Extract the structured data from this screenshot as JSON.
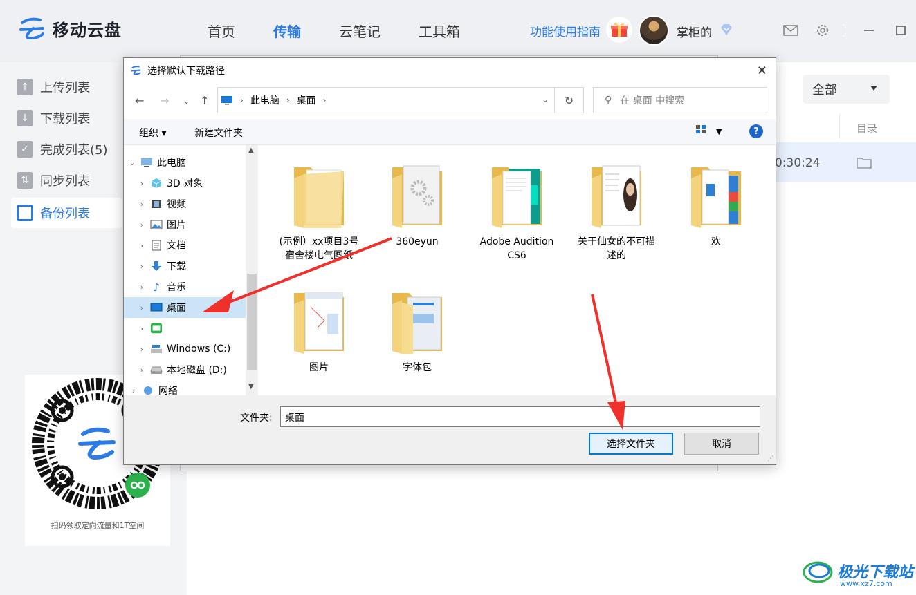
{
  "app": {
    "name": "移动云盘",
    "nav": [
      "首页",
      "传输",
      "云笔记",
      "工具箱"
    ],
    "active_nav": "传输",
    "guide_link": "功能使用指南",
    "username": "掌柜的"
  },
  "sidebar": {
    "items": [
      {
        "label": "上传列表"
      },
      {
        "label": "下载列表"
      },
      {
        "label": "完成列表(5)"
      },
      {
        "label": "同步列表"
      },
      {
        "label": "备份列表"
      }
    ],
    "active": "备份列表",
    "qr_caption": "扫码领取定向流量和1T空间"
  },
  "main": {
    "filter_label": "全部",
    "column_header": "目录",
    "row_time": "0:30:24"
  },
  "dialog": {
    "title": "选择默认下载路径",
    "breadcrumb": [
      "此电脑",
      "桌面"
    ],
    "search_placeholder": "在 桌面 中搜索",
    "toolbar": {
      "organize": "组织",
      "new_folder": "新建文件夹",
      "help": "?"
    },
    "tree": [
      {
        "label": "此电脑",
        "icon": "computer-icon",
        "expanded": true
      },
      {
        "label": "3D 对象",
        "icon": "3d-objects-icon"
      },
      {
        "label": "视频",
        "icon": "video-icon"
      },
      {
        "label": "图片",
        "icon": "pictures-icon"
      },
      {
        "label": "文档",
        "icon": "documents-icon"
      },
      {
        "label": "下载",
        "icon": "download-icon"
      },
      {
        "label": "音乐",
        "icon": "music-icon"
      },
      {
        "label": "桌面",
        "icon": "desktop-icon",
        "selected": true
      },
      {
        "label": "",
        "icon": "iqiyi-icon"
      },
      {
        "label": "Windows (C:)",
        "icon": "drive-c-icon"
      },
      {
        "label": "本地磁盘 (D:)",
        "icon": "drive-d-icon"
      },
      {
        "label": "网络",
        "icon": "network-icon"
      }
    ],
    "files": [
      {
        "name": "(示例）xx项目3号宿舍楼电气图纸"
      },
      {
        "name": "360eyun"
      },
      {
        "name": "Adobe Audition CS6"
      },
      {
        "name": "关于仙女的不可描述的"
      },
      {
        "name": "欢"
      },
      {
        "name": "图片"
      },
      {
        "name": "字体包"
      }
    ],
    "folder_label": "文件夹:",
    "folder_value": "桌面",
    "select_button": "选择文件夹",
    "cancel_button": "取消"
  },
  "watermark": {
    "text": "极光下载站",
    "url": "www.xz7.com"
  },
  "colors": {
    "accent": "#2c7be5",
    "arrow": "#f0302a",
    "selection": "#cce4f7",
    "folder": "#f4d37e"
  }
}
